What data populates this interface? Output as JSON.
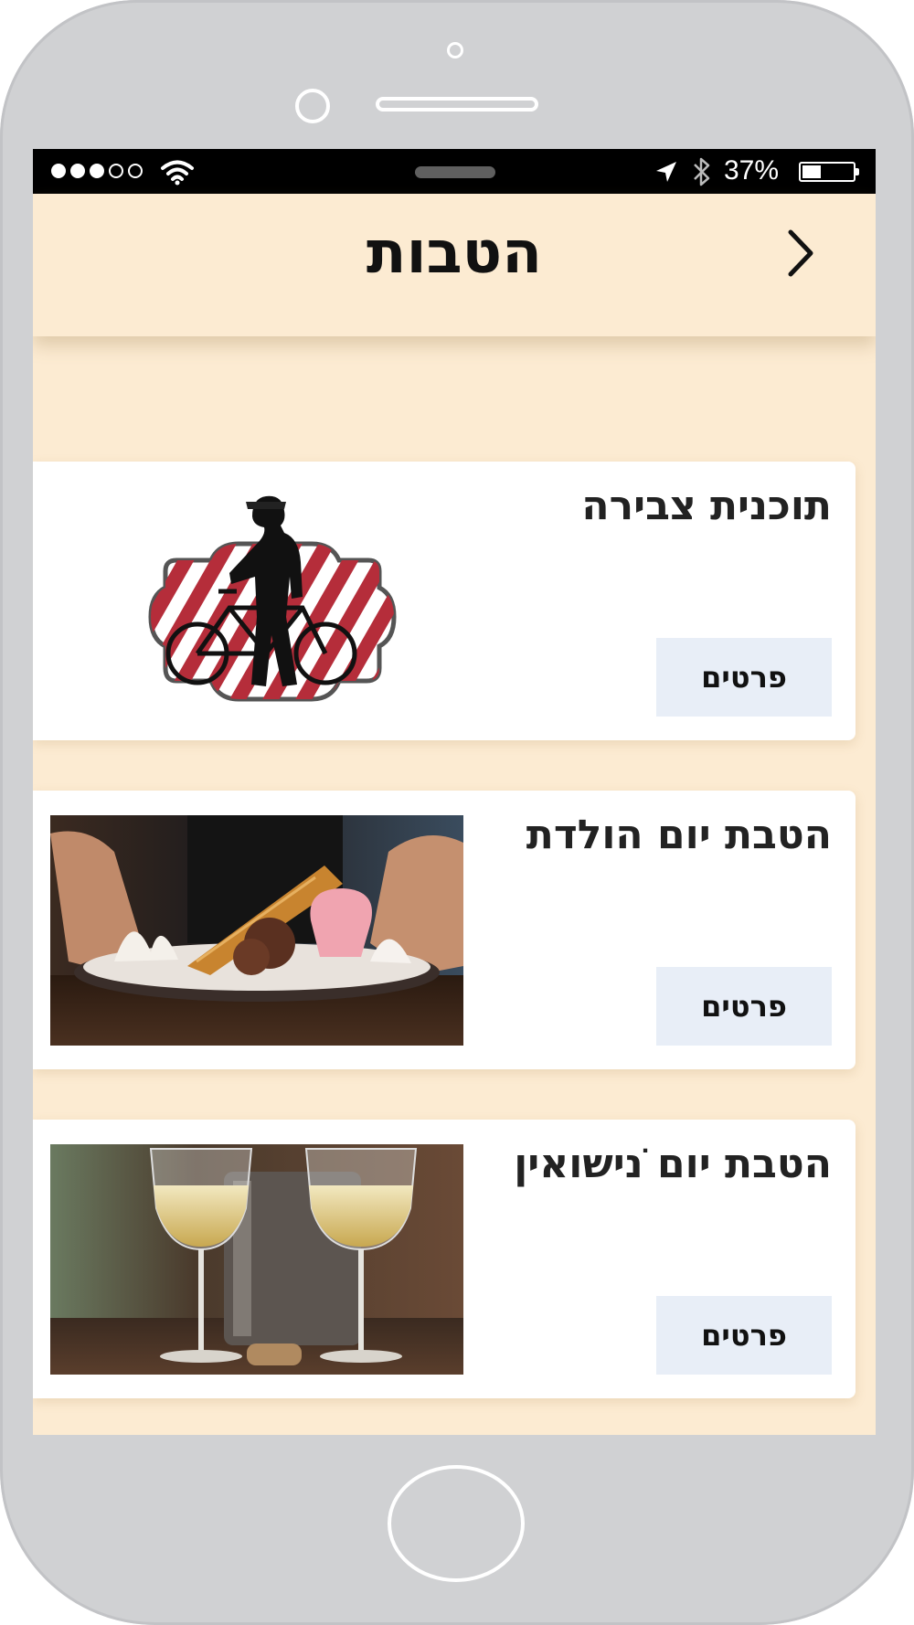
{
  "statusbar": {
    "battery_text": "37%",
    "battery_level": 0.37
  },
  "header": {
    "title": "הטבות"
  },
  "offers": [
    {
      "title": "תוכנית צבירה",
      "button_label": "פרטים",
      "image": "cyclist-logo"
    },
    {
      "title": "הטבת יום הולדת",
      "button_label": "פרטים",
      "image": "dessert-photo"
    },
    {
      "title": "הטבת יום ניׁשואין",
      "button_label": "פרטים",
      "image": "wine-glasses-photo"
    }
  ],
  "colors": {
    "screen_bg": "#fcebd2",
    "card_bg": "#ffffff",
    "button_bg": "#e8eef7",
    "phone_frame": "#d0d1d3"
  },
  "icons": [
    "back-chevron-icon",
    "wifi-icon",
    "location-arrow-icon",
    "bluetooth-icon",
    "battery-icon"
  ]
}
